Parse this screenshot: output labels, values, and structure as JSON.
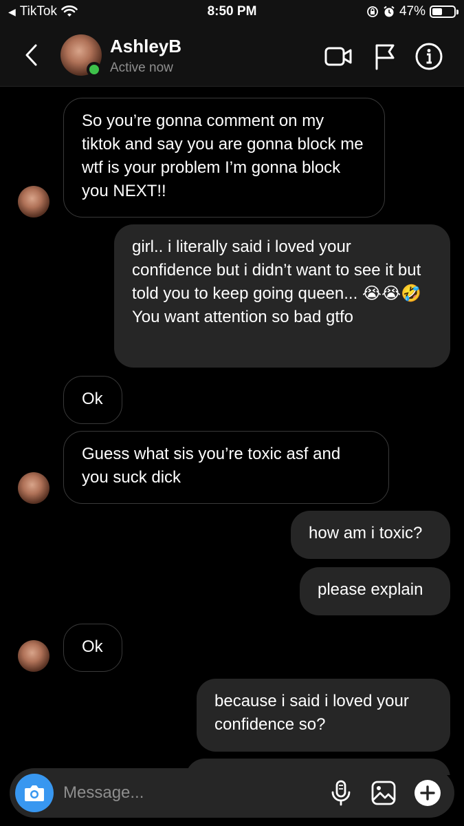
{
  "status_bar": {
    "back_app": "TikTok",
    "time": "8:50 PM",
    "battery": "47%",
    "battery_level": 0.47
  },
  "header": {
    "name": "AshleyB",
    "status": "Active now"
  },
  "messages": [
    {
      "side": "in",
      "text": "So you’re gonna comment on my tiktok and say you are gonna block me wtf is your problem I’m gonna block you NEXT!!"
    },
    {
      "side": "out",
      "text": "girl.. i literally said i loved your confidence but i didn’t want to see it but told you to keep going queen... 😭😭🤣 You want attention so bad gtfo"
    },
    {
      "side": "in",
      "text": "Ok"
    },
    {
      "side": "in",
      "text": "Guess what sis you’re toxic asf and you suck dick"
    },
    {
      "side": "out",
      "text": "how am i toxic?"
    },
    {
      "side": "out",
      "text": "please explain"
    },
    {
      "side": "in",
      "text": "Ok"
    },
    {
      "side": "out",
      "text": "because i said i loved your confidence so?"
    }
  ],
  "composer": {
    "placeholder": "Message..."
  },
  "colors": {
    "background": "#000000",
    "bar": "#121212",
    "outgoing_bubble": "#262626",
    "online": "#3ec14a",
    "camera": "#3897f0"
  }
}
